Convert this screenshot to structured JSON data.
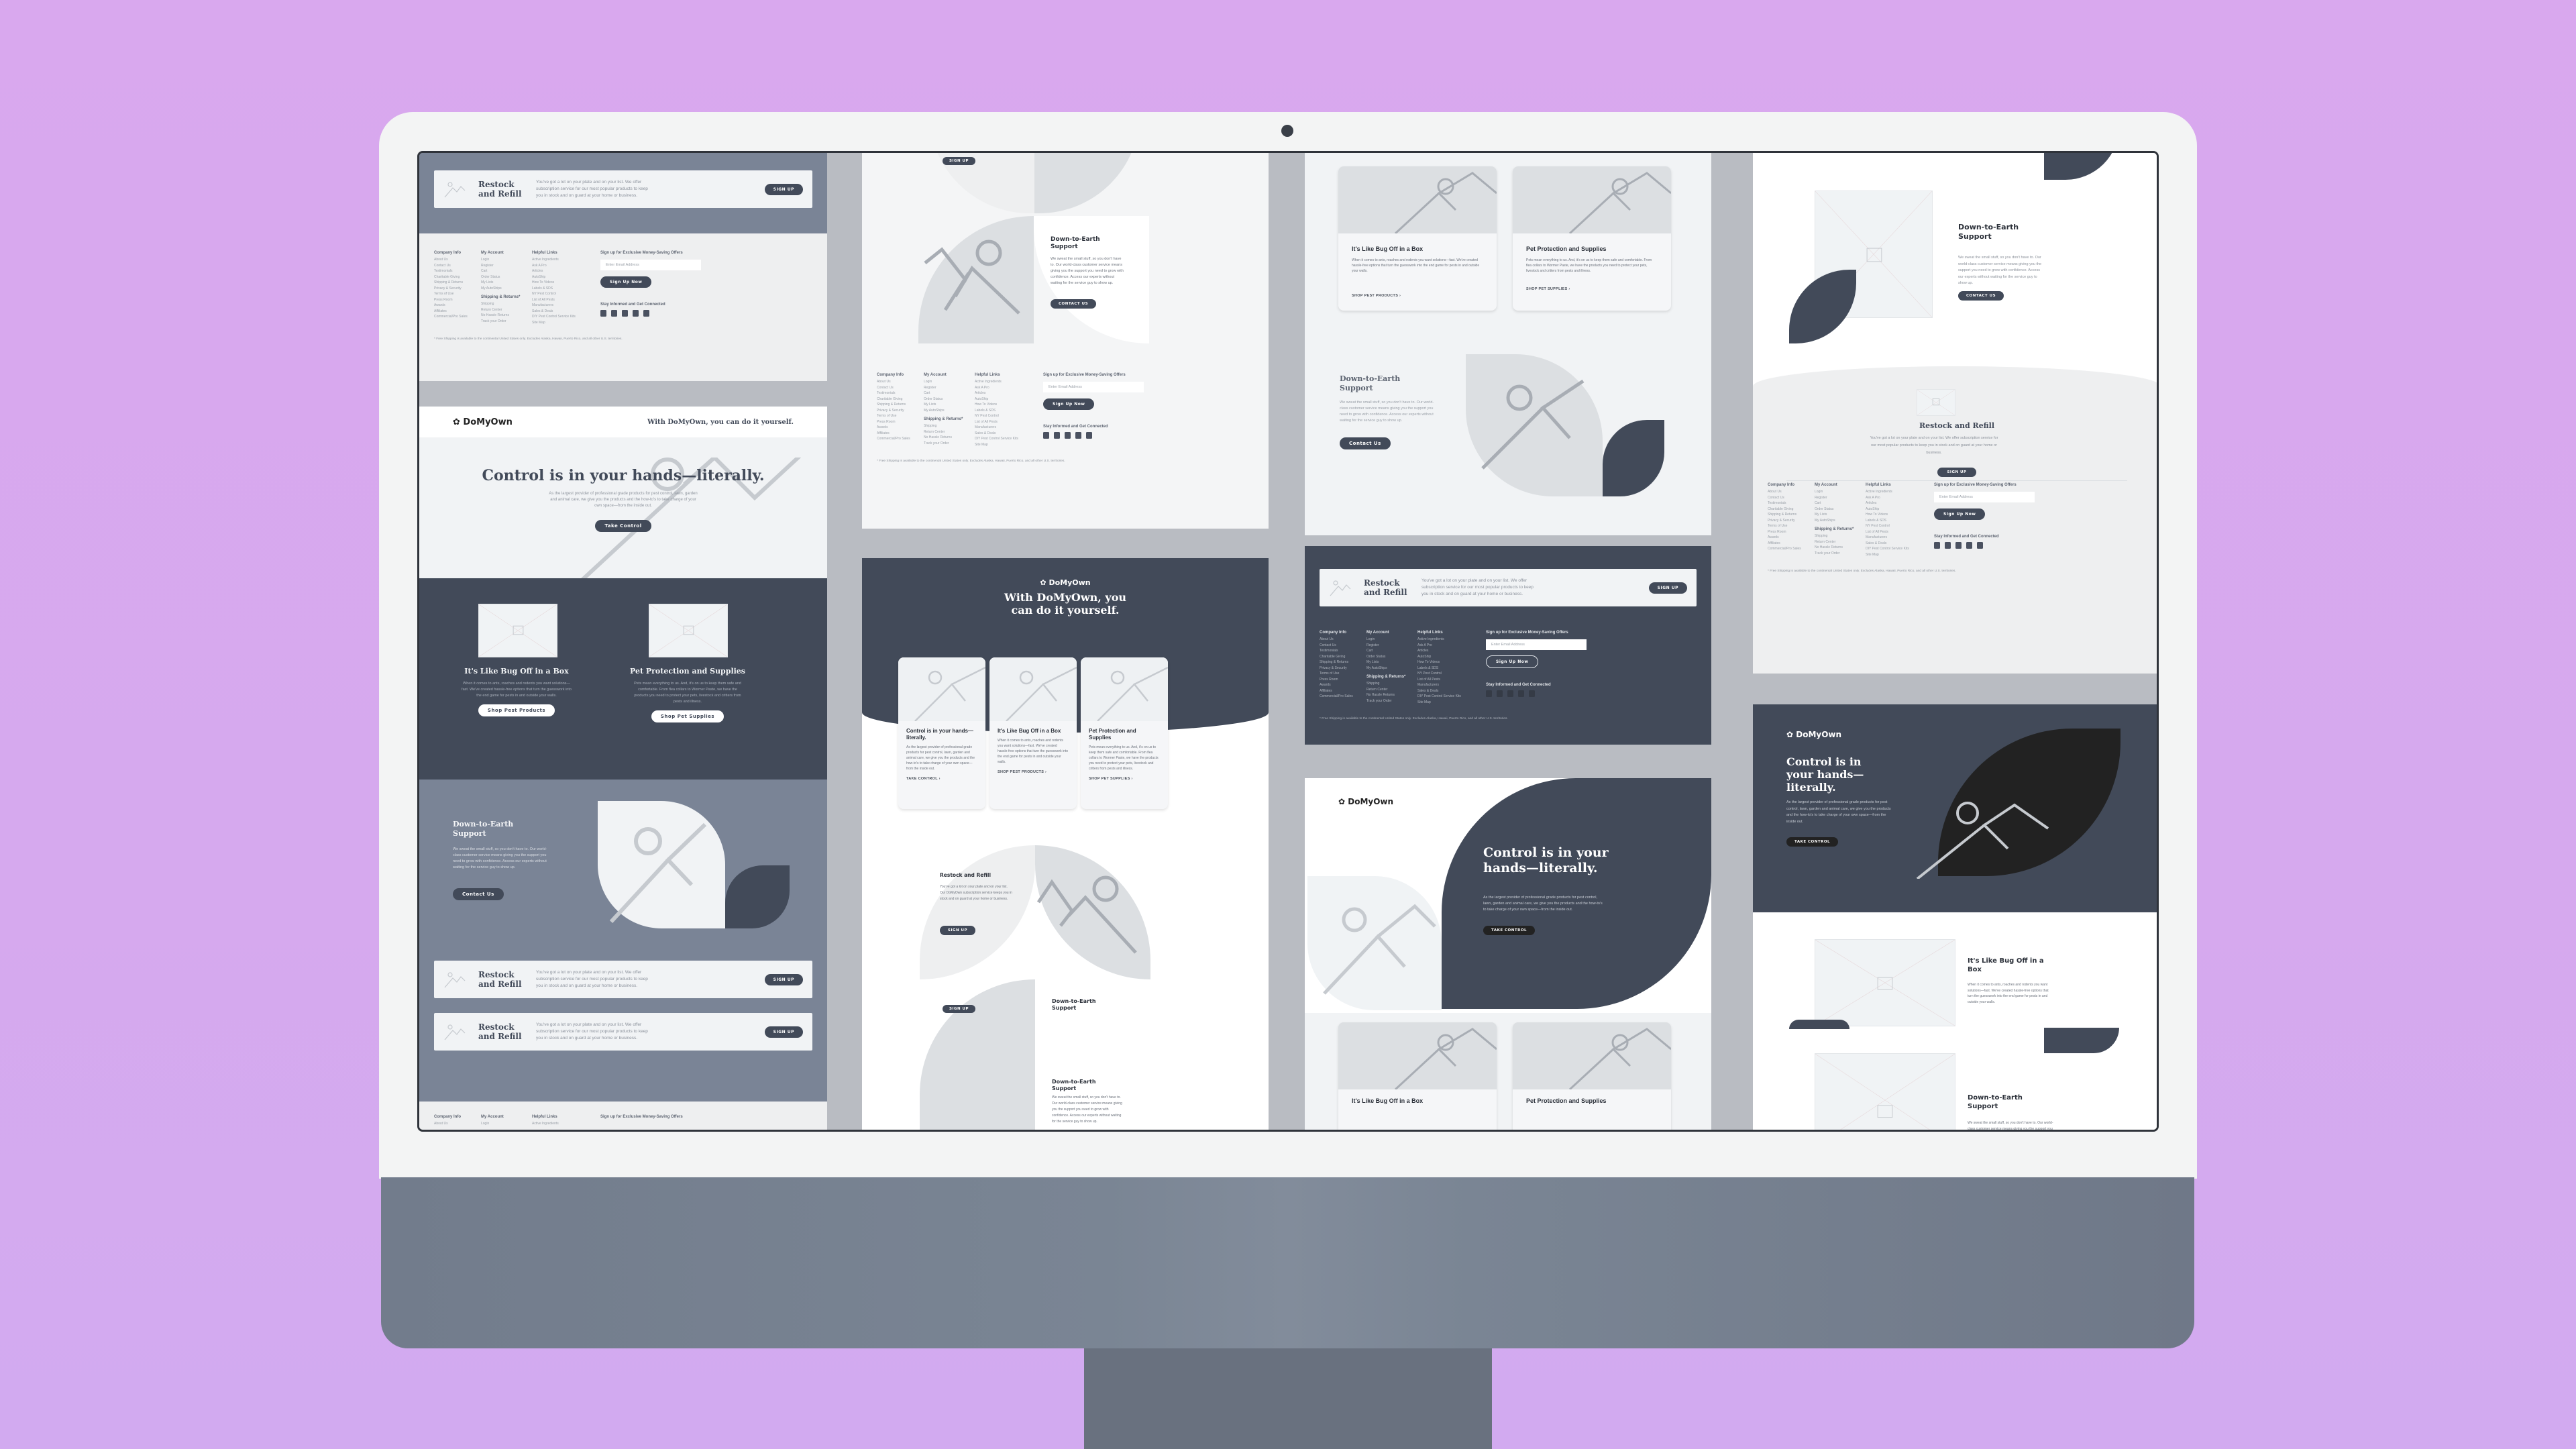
{
  "brand": {
    "name": "DoMyOwn",
    "tagline": "With DoMyOwn, you can do it yourself.",
    "tagline_split": [
      "With DoMyOwn, you",
      "can do it yourself."
    ]
  },
  "colors": {
    "background": "#d9a8ee",
    "dark_slate": "#424a59",
    "slate": "#7a8496",
    "off_white": "#f1f3f5",
    "bezel": "#f3f4f4",
    "chin": "#7a8594"
  },
  "hero": {
    "title": "Control is in your hands—literally.",
    "body": "As the largest provider of professional grade products for pest control, lawn, garden and animal care, we give you the products and the how-to's to take charge of your own space—from the inside out.",
    "cta": "Take Control",
    "cta_caps": "TAKE CONTROL"
  },
  "features": [
    {
      "title": "It's Like Bug Off in a Box",
      "body": "When it comes to ants, roaches and rodents you want solutions—fast. We've created hassle-free options that turn the guesswork into the end game for pests in and outside your walls.",
      "cta": "Shop Pest Products",
      "cta_caps": "SHOP PEST PRODUCTS ›"
    },
    {
      "title": "Pet Protection and Supplies",
      "body": "Pets mean everything to us. And, it's on us to keep them safe and comfortable. From flea collars to Wormer Paste, we have the products you need to protect your pets, livestock and critters from pests and illness.",
      "cta": "Shop Pet Supplies",
      "cta_caps": "SHOP PET SUPPLIES ›"
    },
    {
      "title": "Control is in your hands—literally.",
      "body": "As the largest provider of professional grade products for pest control, lawn, garden and animal care, we give you the products and the how-to's to take charge of your own space—from the inside out.",
      "cta_caps": "TAKE CONTROL ›"
    }
  ],
  "support": {
    "title": "Down-to-Earth Support",
    "body": "We sweat the small stuff, so you don't have to. Our world-class customer service means giving you the support you need to grow with confidence. Access our experts without waiting for the service guy to show up.",
    "cta": "Contact Us",
    "cta_caps": "CONTACT US"
  },
  "restock": {
    "title": "Restock and Refill",
    "title_l1": "Restock",
    "title_l2": "and Refill",
    "body": "You've got a lot on your plate and on your list. We offer subscription service for our most popular products to keep you in stock and on guard at your home or business.",
    "body_alt": "You've got a lot on your plate and on your list. Our DoMyOwn subscription service keeps you in stock and on guard at your home or business.",
    "cta": "SIGN UP"
  },
  "footer": {
    "company": {
      "heading": "Company Info",
      "links": [
        "About Us",
        "Contact Us",
        "Testimonials",
        "Charitable Giving",
        "Shipping & Returns",
        "Privacy & Security",
        "Terms of Use",
        "Press Room",
        "Awards",
        "Affiliates",
        "Commercial/Pro Sales"
      ]
    },
    "account": {
      "heading": "My Account",
      "links": [
        "Login",
        "Register",
        "Cart",
        "Order Status",
        "My Lists",
        "My AutoShips"
      ]
    },
    "shipping": {
      "heading": "Shipping & Returns*",
      "links": [
        "Shipping",
        "Return Center",
        "No Hassle Returns",
        "Track your Order"
      ]
    },
    "helpful": {
      "heading": "Helpful Links",
      "links": [
        "Active Ingredients",
        "Ask A Pro",
        "Articles",
        "AutoShip",
        "How To Videos",
        "Labels & SDS",
        "NY Pest Control",
        "List of All Pests",
        "Manufacturers",
        "Sales & Deals",
        "DIY Pest Control Service Kits",
        "Site Map"
      ]
    },
    "signup": {
      "heading": "Sign up for Exclusive Money-Saving Offers",
      "placeholder": "Enter Email Address",
      "button": "Sign Up Now"
    },
    "connect": {
      "heading": "Stay Informed and Get Connected",
      "icons": [
        "facebook-icon",
        "twitter-icon",
        "youtube-icon",
        "instagram-icon",
        "linkedin-icon"
      ]
    },
    "note": "* Free Shipping is available to the continental United States only. Excludes Alaska, Hawaii, Puerto Rico, and all other U.S. territories."
  }
}
